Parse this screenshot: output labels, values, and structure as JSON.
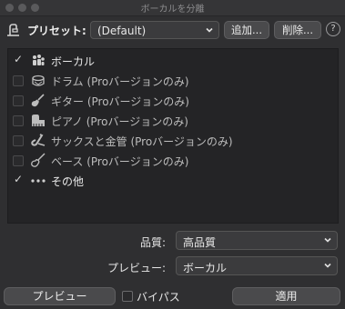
{
  "window": {
    "title": "ボーカルを分離"
  },
  "preset": {
    "label": "プリセット:",
    "value": "(Default)",
    "add_label": "追加...",
    "delete_label": "削除...",
    "help_label": "?"
  },
  "stems": [
    {
      "label": "ボーカル",
      "checked": true,
      "enabled": true,
      "icon": "vocals-icon"
    },
    {
      "label": "ドラム (Proバージョンのみ)",
      "checked": false,
      "enabled": false,
      "icon": "drum-icon"
    },
    {
      "label": "ギター (Proバージョンのみ)",
      "checked": false,
      "enabled": false,
      "icon": "guitar-icon"
    },
    {
      "label": "ピアノ (Proバージョンのみ)",
      "checked": false,
      "enabled": false,
      "icon": "piano-icon"
    },
    {
      "label": "サックスと金管 (Proバージョンのみ)",
      "checked": false,
      "enabled": false,
      "icon": "saxophone-icon"
    },
    {
      "label": "ベース (Proバージョンのみ)",
      "checked": false,
      "enabled": false,
      "icon": "bass-guitar-icon"
    },
    {
      "label": "その他",
      "checked": true,
      "enabled": true,
      "icon": "more-dots-icon"
    }
  ],
  "quality": {
    "label": "品質:",
    "value": "高品質"
  },
  "preview_select": {
    "label": "プレビュー:",
    "value": "ボーカル"
  },
  "footer": {
    "preview_button": "プレビュー",
    "bypass_label": "バイパス",
    "bypass_checked": false,
    "apply_button": "適用"
  }
}
